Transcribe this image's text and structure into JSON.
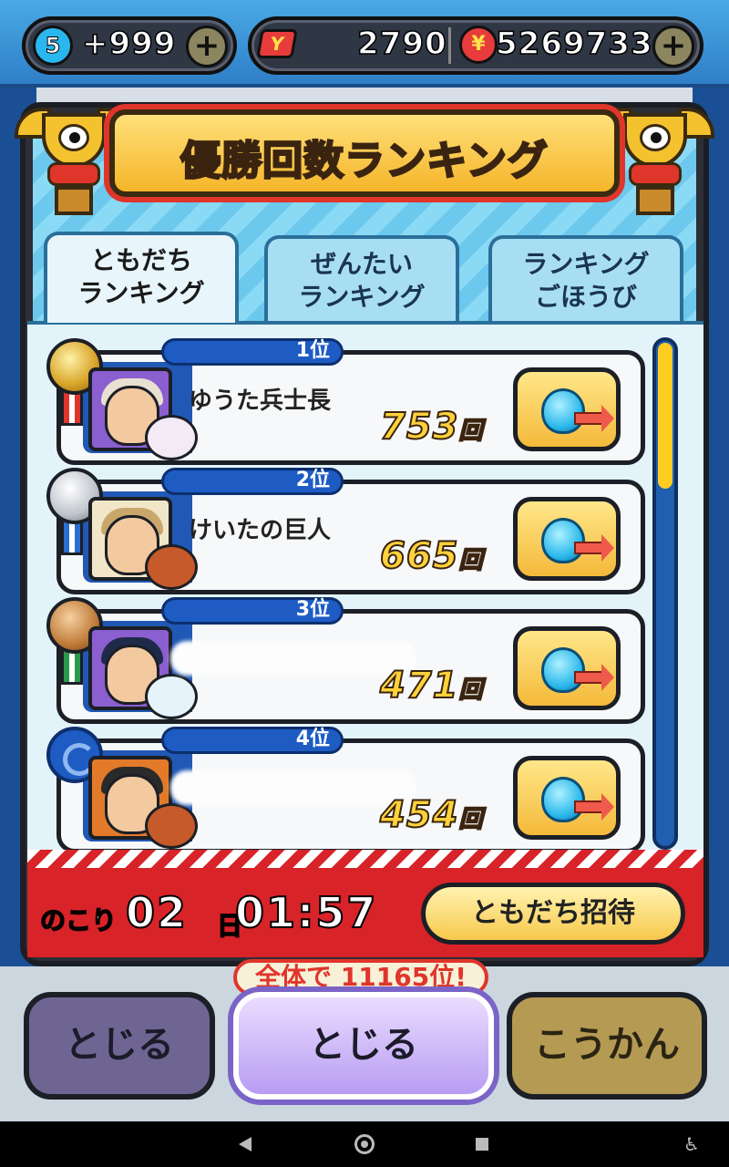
{
  "resources": {
    "stamina_level": "5",
    "stamina": "+999",
    "tickets": "2790",
    "coins": "5269733",
    "ticket_icon": "Y",
    "coin_icon": "¥"
  },
  "title": "優勝回数ランキング",
  "tabs": [
    {
      "label": "ともだち\nランキング",
      "active": true
    },
    {
      "label": "ぜんたい\nランキング",
      "active": false
    },
    {
      "label": "ランキング\nごほうび",
      "active": false
    }
  ],
  "rankings": [
    {
      "rank_label": "1位",
      "name": "ゆうた兵士長",
      "score": "753",
      "unit": "回",
      "medal": "gold"
    },
    {
      "rank_label": "2位",
      "name": "けいたの巨人",
      "score": "665",
      "unit": "回",
      "medal": "silver"
    },
    {
      "rank_label": "3位",
      "name": "",
      "score": "471",
      "unit": "回",
      "medal": "bronze"
    },
    {
      "rank_label": "4位",
      "name": "",
      "score": "454",
      "unit": "回",
      "medal": "swirl"
    }
  ],
  "timer": {
    "remaining_label": "のこり",
    "days": "02",
    "day_unit": "日",
    "time": "01:57"
  },
  "invite_label": "ともだち招待",
  "overall_rank": "全体で 11165位!",
  "bottom_buttons": {
    "left": "とじる",
    "center": "とじる",
    "right": "こうかん"
  },
  "colors": {
    "accent_gold": "#ffd23a",
    "ribbon_blue": "#1e5cc4",
    "timer_red": "#d82329",
    "panel_blue": "#7dd2f0"
  }
}
